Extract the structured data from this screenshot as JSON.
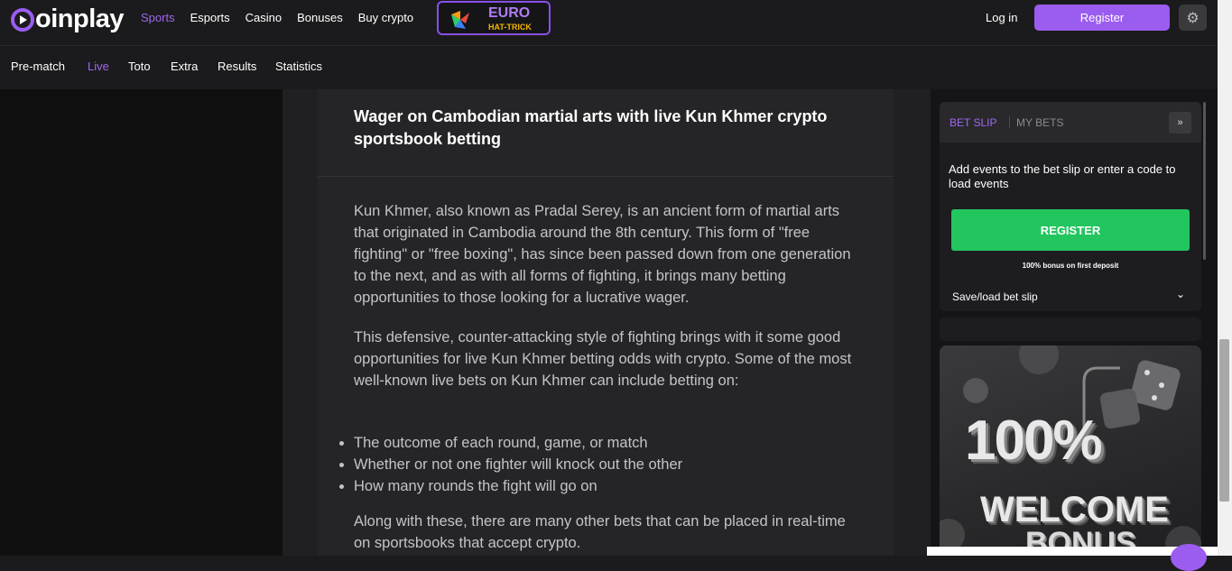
{
  "header": {
    "logo_text": "oinplay",
    "nav": [
      "Sports",
      "Esports",
      "Casino",
      "Bonuses",
      "Buy crypto"
    ],
    "active_nav": "Sports",
    "promo": {
      "line1": "EURO",
      "line2": "HAT-TRICK"
    },
    "login_label": "Log in",
    "register_label": "Register"
  },
  "subnav": {
    "items": [
      "Pre-match",
      "Live",
      "Toto",
      "Extra",
      "Results",
      "Statistics"
    ],
    "active": "Live"
  },
  "article": {
    "title": "Wager on Cambodian martial arts with live Kun Khmer crypto sportsbook betting",
    "paragraphs": [
      "Kun Khmer, also known as Pradal Serey, is an ancient form of martial arts that originated in Cambodia around the 8th century. This form of \"free fighting\" or \"free boxing\", has since been passed down from one generation to the next, and as with all forms of fighting, it brings many betting opportunities to those looking for a lucrative wager.",
      "This defensive, counter-attacking style of fighting brings with it some good opportunities for live Kun Khmer betting odds with crypto. Some of the most well-known live bets on Kun Khmer can include betting on:",
      "Along with these, there are many other bets that can be placed in real-time on sportsbooks that accept crypto."
    ],
    "bullets": [
      "The outcome of each round, game, or match",
      "Whether or not one fighter will knock out the other",
      "How many rounds the fight will go on"
    ]
  },
  "betslip": {
    "tab_active": "BET SLIP",
    "tab_other": "MY BETS",
    "collapse_glyph": "»",
    "message": "Add events to the bet slip or enter a code to load events",
    "register_label": "REGISTER",
    "bonus_note": "100% bonus on first deposit",
    "save_load_label": "Save/load bet slip",
    "chevron": "⌄"
  },
  "banner": {
    "line1": "100%",
    "line2": "WELCOME",
    "line3": "BONUS"
  },
  "colors": {
    "accent": "#9b5cf0",
    "green": "#22c55e",
    "background": "#1b1b1d"
  }
}
